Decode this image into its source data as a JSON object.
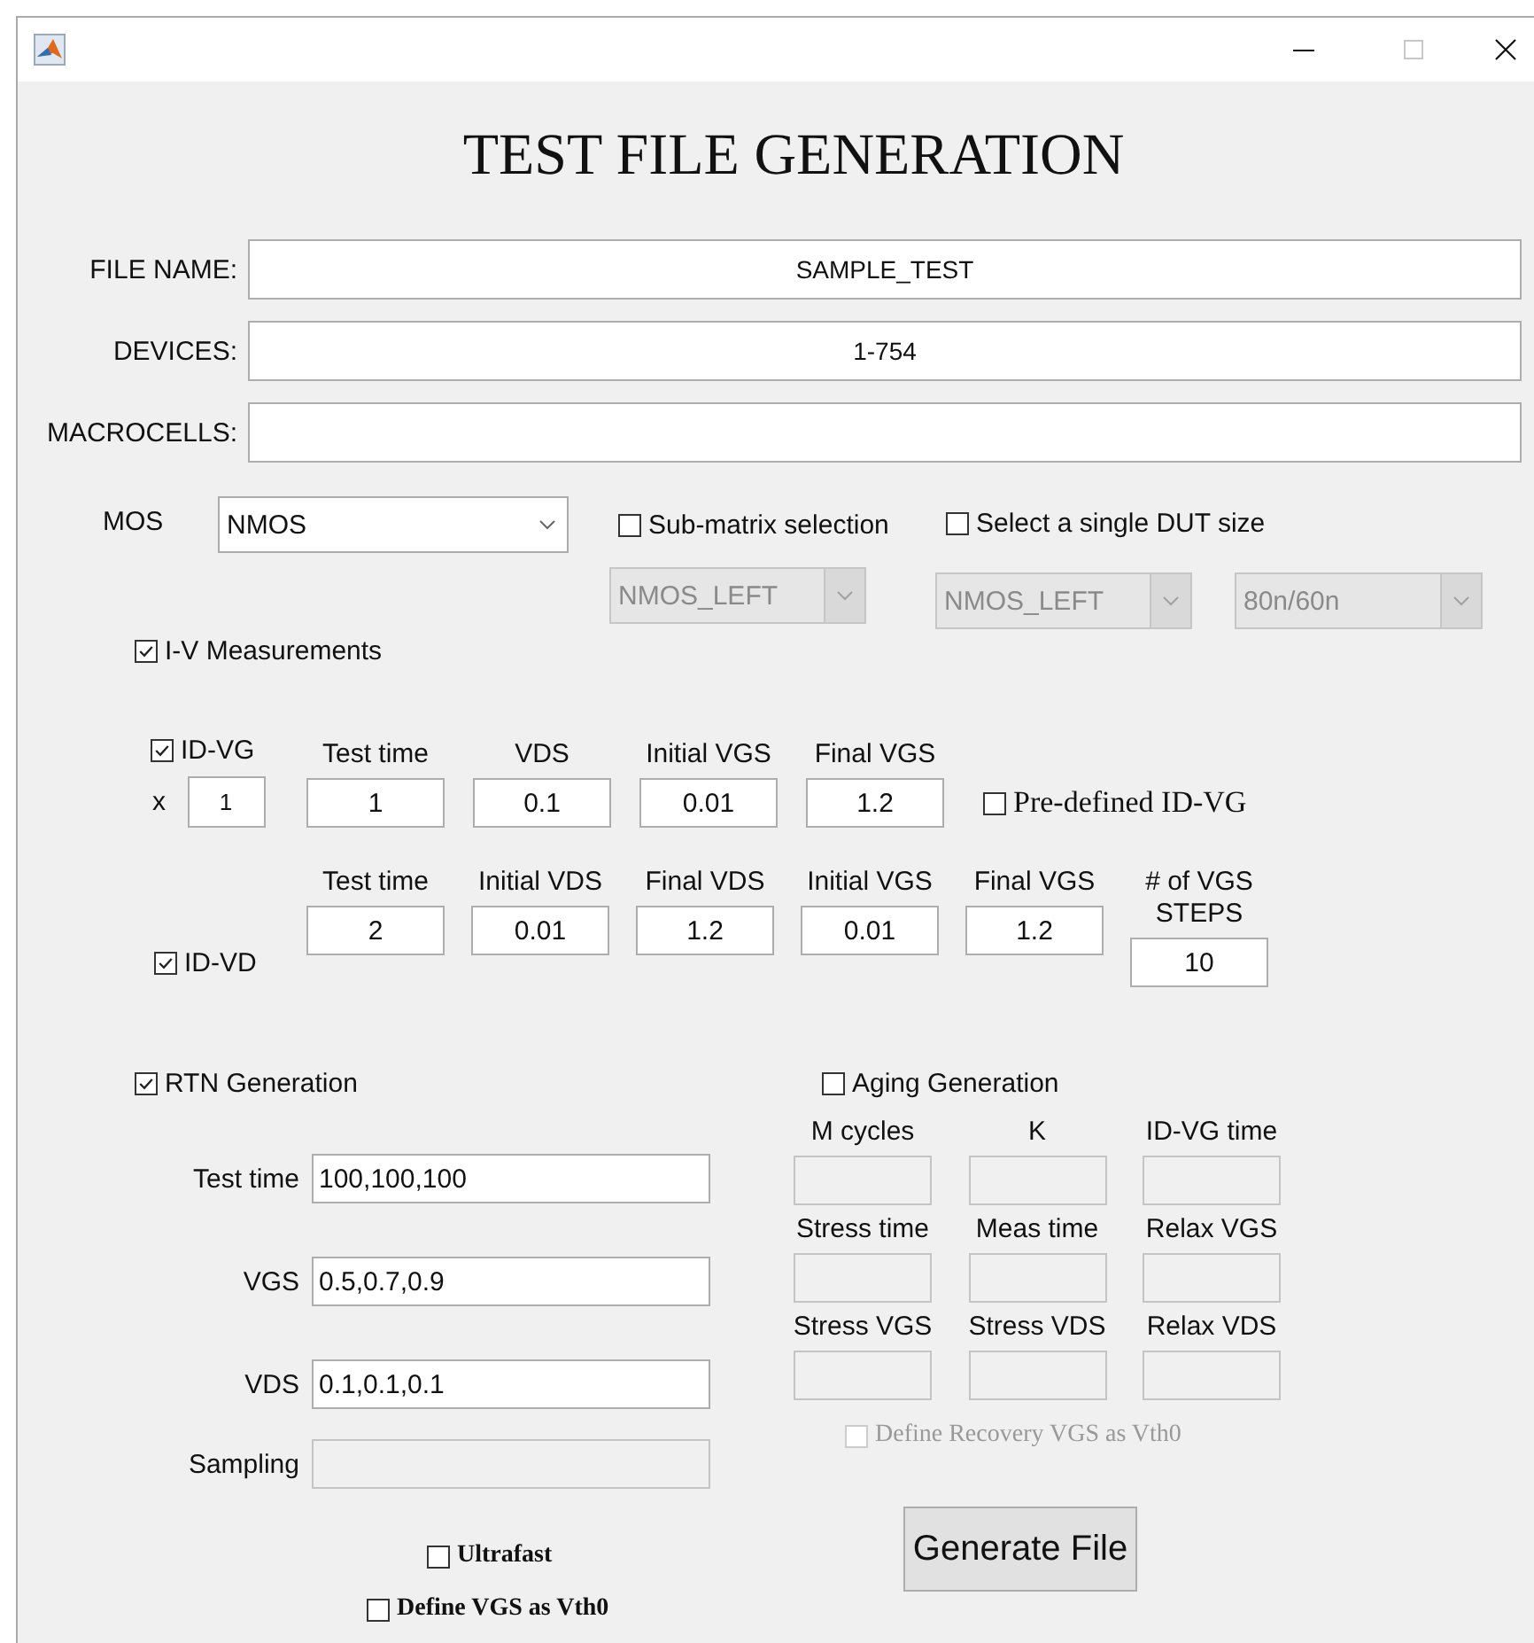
{
  "window": {
    "maximize_disabled": true
  },
  "heading": "TEST FILE GENERATION",
  "text_fields": [
    {
      "label": "FILE NAME:",
      "value": "SAMPLE_TEST"
    },
    {
      "label": "DEVICES:",
      "value": "1-754"
    },
    {
      "label": "MACROCELLS:"
    }
  ],
  "mos": {
    "label": "MOS",
    "value": "NMOS"
  },
  "submatrix": {
    "label": "Sub-matrix selection",
    "checked": false,
    "dropdown": {
      "value": "NMOS_LEFT",
      "disabled": true
    }
  },
  "single_dut": {
    "label": "Select a single DUT size",
    "checked": false,
    "dropdowns": [
      {
        "value": "NMOS_LEFT",
        "disabled": true
      },
      {
        "value": "80n/60n",
        "disabled": true
      }
    ]
  },
  "iv_measurements": {
    "label": "I-V Measurements",
    "checked": true
  },
  "id_vg": {
    "label": "ID-VG",
    "checked": true,
    "multiplier_label": "x",
    "multiplier": "1",
    "params": [
      {
        "label": "Test time",
        "value": "1"
      },
      {
        "label": "VDS",
        "value": "0.1"
      },
      {
        "label": "Initial VGS",
        "value": "0.01"
      },
      {
        "label": "Final VGS",
        "value": "1.2"
      }
    ],
    "predefined": {
      "label": "Pre-defined ID-VG",
      "checked": false
    }
  },
  "id_vd": {
    "label": "ID-VD",
    "checked": true,
    "params": [
      {
        "label": "Test time",
        "value": "2"
      },
      {
        "label": "Initial VDS",
        "value": "0.01"
      },
      {
        "label": "Final  VDS",
        "value": "1.2"
      },
      {
        "label": "Initial VGS",
        "value": "0.01"
      },
      {
        "label": "Final VGS",
        "value": "1.2"
      },
      {
        "label": "# of VGS STEPS",
        "value": "10"
      }
    ]
  },
  "rtn": {
    "label": "RTN Generation",
    "checked": true,
    "fields": [
      {
        "label": "Test time",
        "value": "100,100,100",
        "disabled": false
      },
      {
        "label": "VGS",
        "value": "0.5,0.7,0.9",
        "disabled": false
      },
      {
        "label": "VDS",
        "value": "0.1,0.1,0.1",
        "disabled": false
      },
      {
        "label": "Sampling",
        "disabled": true
      }
    ],
    "ultrafast": {
      "label": "Ultrafast",
      "checked": false
    },
    "define_vgs": {
      "label": "Define VGS as Vth0",
      "checked": false
    }
  },
  "aging": {
    "label": "Aging Generation",
    "checked": false,
    "params": [
      {
        "label": "M cycles",
        "disabled": true
      },
      {
        "label": "K",
        "disabled": true
      },
      {
        "label": "ID-VG time",
        "disabled": true
      },
      {
        "label": "Stress time",
        "disabled": true
      },
      {
        "label": "Meas time",
        "disabled": true
      },
      {
        "label": "Relax VGS",
        "disabled": true
      },
      {
        "label": "Stress VGS",
        "disabled": true
      },
      {
        "label": "Stress VDS",
        "disabled": true
      },
      {
        "label": "Relax VDS",
        "disabled": true
      }
    ],
    "define_recovery": {
      "label": "Define Recovery VGS as Vth0",
      "checked": false,
      "disabled": true
    }
  },
  "generate_button": "Generate File"
}
